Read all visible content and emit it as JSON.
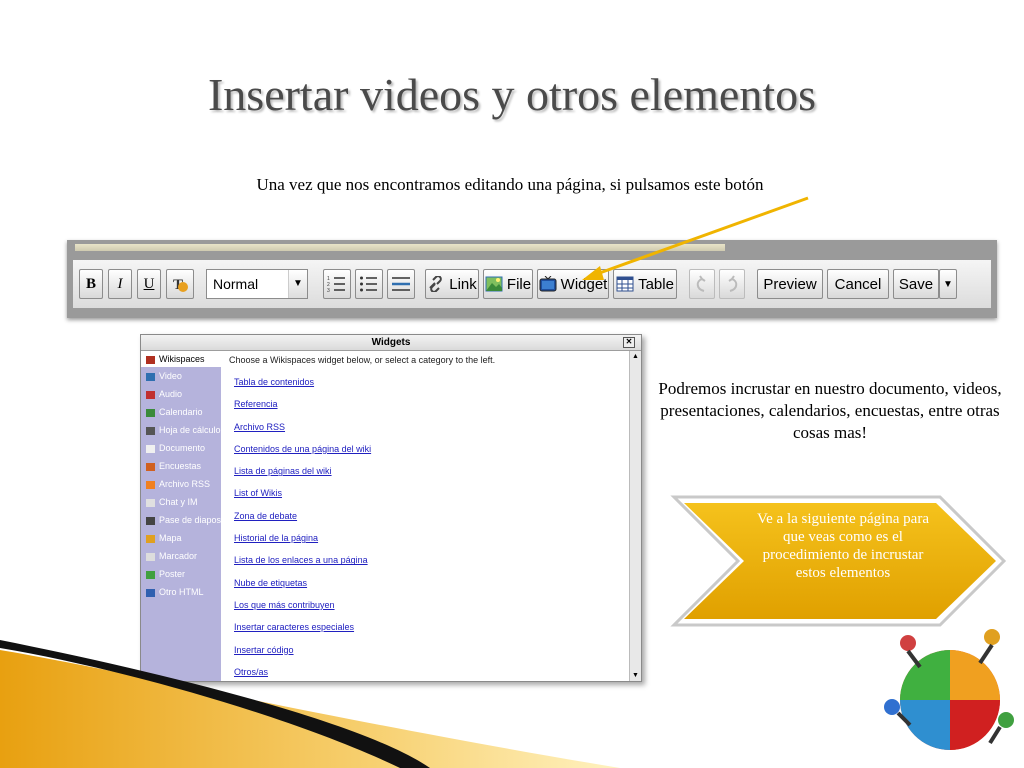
{
  "slide": {
    "title": "Insertar videos y otros elementos",
    "caption": "Una vez que nos encontramos editando una página, si pulsamos este botón",
    "description": "Podremos incrustar en nuestro documento, videos, presentaciones, calendarios, encuestas, entre otras cosas mas!",
    "callout": "Ve a la siguiente página para que veas como es el procedimiento de incrustar estos elementos"
  },
  "toolbar": {
    "bold": "B",
    "italic": "I",
    "underline": "U",
    "format_value": "Normal",
    "link": "Link",
    "file": "File",
    "widget": "Widget",
    "table": "Table",
    "preview": "Preview",
    "cancel": "Cancel",
    "save": "Save"
  },
  "widgets_panel": {
    "title": "Widgets",
    "intro": "Choose a Wikispaces widget below, or select a category to the left.",
    "categories": [
      {
        "label": "Wikispaces",
        "color": "#b03020"
      },
      {
        "label": "Video",
        "color": "#2f6fb0"
      },
      {
        "label": "Audio",
        "color": "#c03030"
      },
      {
        "label": "Calendario",
        "color": "#3a8a3a"
      },
      {
        "label": "Hoja de cálculo",
        "color": "#555555"
      },
      {
        "label": "Documento",
        "color": "#f0f0f0"
      },
      {
        "label": "Encuestas",
        "color": "#d06020"
      },
      {
        "label": "Archivo RSS",
        "color": "#f08020"
      },
      {
        "label": "Chat y IM",
        "color": "#e0e0e0"
      },
      {
        "label": "Pase de diapositivas",
        "color": "#444444"
      },
      {
        "label": "Mapa",
        "color": "#e0a020"
      },
      {
        "label": "Marcador",
        "color": "#dddddd"
      },
      {
        "label": "Poster",
        "color": "#40a040"
      },
      {
        "label": "Otro HTML",
        "color": "#3060b0"
      }
    ],
    "links": [
      "Tabla de contenidos",
      "Referencia",
      "Archivo RSS",
      "Contenidos de una página del wiki",
      "Lista de páginas del wiki",
      "List of Wikis",
      "Zona de debate",
      "Historial de la página",
      "Lista de los enlaces a una página",
      "Nube de etiquetas",
      "Los que más contribuyen",
      "Insertar caracteres especiales",
      "Insertar código",
      "Otros/as"
    ]
  },
  "colors": {
    "title": "#4a4a4a",
    "callout_fill": "#f0b400",
    "sidebar": "#b5b3dc",
    "arrow": "#f0b400"
  }
}
